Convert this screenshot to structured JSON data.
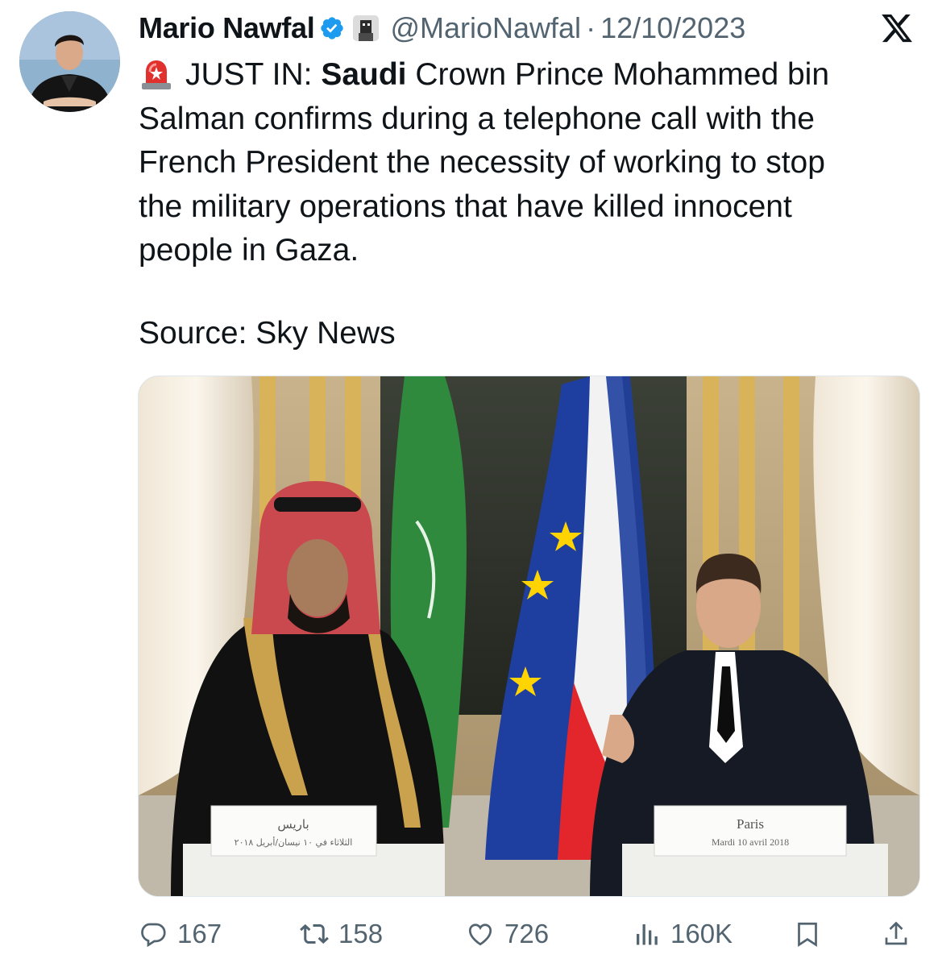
{
  "tweet": {
    "display_name": "Mario Nawfal",
    "handle": "@MarioNawfal",
    "separator": "·",
    "date": "12/10/2023",
    "text_lines": [
      {
        "prefix": "JUST IN: ",
        "bold": "Saudi",
        "rest": " Crown Prince Mohammed bin"
      },
      "Salman confirms during a telephone call with the",
      "French President the necessity of working to stop",
      "the military operations that have killed innocent",
      "people in Gaza."
    ],
    "source": "Source: Sky News"
  },
  "media": {
    "left_podium_arabic_title": "باريس",
    "left_podium_arabic_date": "الثلاثاء في ١٠ نيسان/أبريل ٢٠١٨",
    "right_podium_title": "Paris",
    "right_podium_date": "Mardi 10 avril 2018"
  },
  "actions": {
    "replies": "167",
    "reposts": "158",
    "likes": "726",
    "views": "160K"
  },
  "icons": {
    "verified": "verified-badge-icon",
    "affiliate": "affiliate-badge-icon",
    "x_logo": "x-logo-icon",
    "siren": "siren-emoji-icon",
    "reply": "reply-icon",
    "repost": "repost-icon",
    "like": "heart-icon",
    "views": "views-icon",
    "bookmark": "bookmark-icon",
    "share": "share-icon"
  },
  "colors": {
    "verified_blue": "#1d9bf0",
    "muted_text": "#536471",
    "primary_text": "#0f1419"
  }
}
